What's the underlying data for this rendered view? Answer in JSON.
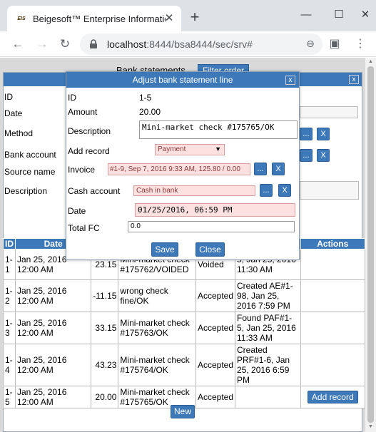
{
  "browser": {
    "tab_title": "Beigesoft™ Enterprise Information",
    "favicon_text": "EIS",
    "url_host": "localhost",
    "url_rest": ":8444/bsa8444/sec/srv#"
  },
  "page": {
    "bank_title": "Bank statements",
    "filter_label": "Filter order",
    "left_labels": {
      "id": "ID",
      "date": "Date",
      "method": "Method",
      "bank_account": "Bank account",
      "source_name": "Source name",
      "description": "Description"
    },
    "table": {
      "headers": [
        "ID",
        "Date",
        "Actions"
      ],
      "rows": [
        {
          "id": "1-1",
          "date": "Jan 25, 2016 12:00 AM",
          "amount": "23.15",
          "desc": "Mini-market check #175762/VOIDED",
          "status": "Voided",
          "result": "5, Jan 25, 2016 11:30 AM",
          "action": ""
        },
        {
          "id": "1-2",
          "date": "Jan 25, 2016 12:00 AM",
          "amount": "-11.15",
          "desc": "wrong check fine/OK",
          "status": "Accepted",
          "result": "Created AE#1-98, Jan 25, 2016 7:59 PM",
          "action": ""
        },
        {
          "id": "1-3",
          "date": "Jan 25, 2016 12:00 AM",
          "amount": "33.15",
          "desc": "Mini-market check #175763/OK",
          "status": "Accepted",
          "result": "Found PAF#1-5, Jan 25, 2016 11:33 AM",
          "action": ""
        },
        {
          "id": "1-4",
          "date": "Jan 25, 2016 12:00 AM",
          "amount": "43.23",
          "desc": "Mini-market check #175764/OK",
          "status": "Accepted",
          "result": "Created PRF#1-6, Jan 25, 2016 6:59 PM",
          "action": ""
        },
        {
          "id": "1-5",
          "date": "Jan 25, 2016 12:00 AM",
          "amount": "20.00",
          "desc": "Mini-market check #175765/OK",
          "status": "Accepted",
          "result": "",
          "action": "Add record"
        }
      ]
    },
    "new_label": "New"
  },
  "modal": {
    "title": "Adjust bank statement line",
    "close_label": "x",
    "id_label": "ID",
    "id_value": "1-5",
    "amount_label": "Amount",
    "amount_value": "20.00",
    "description_label": "Description",
    "description_value": "Mini-market check #175765/OK",
    "add_record_label": "Add record",
    "add_record_value": "Payment",
    "invoice_label": "Invoice",
    "invoice_value": "#1-9, Sep 7, 2016 9:33 AM, 125.80 / 0.00",
    "cash_account_label": "Cash account",
    "cash_account_value": "Cash in bank",
    "date_label": "Date",
    "date_value": "01/25/2016, 06:59 PM",
    "total_fc_label": "Total FC",
    "total_fc_value": "0.0",
    "save_label": "Save",
    "close_button_label": "Close",
    "ellipsis": "...",
    "clear": "X"
  },
  "colors": {
    "accent": "#3d79b8",
    "invalid_bg": "#fde0e0"
  }
}
